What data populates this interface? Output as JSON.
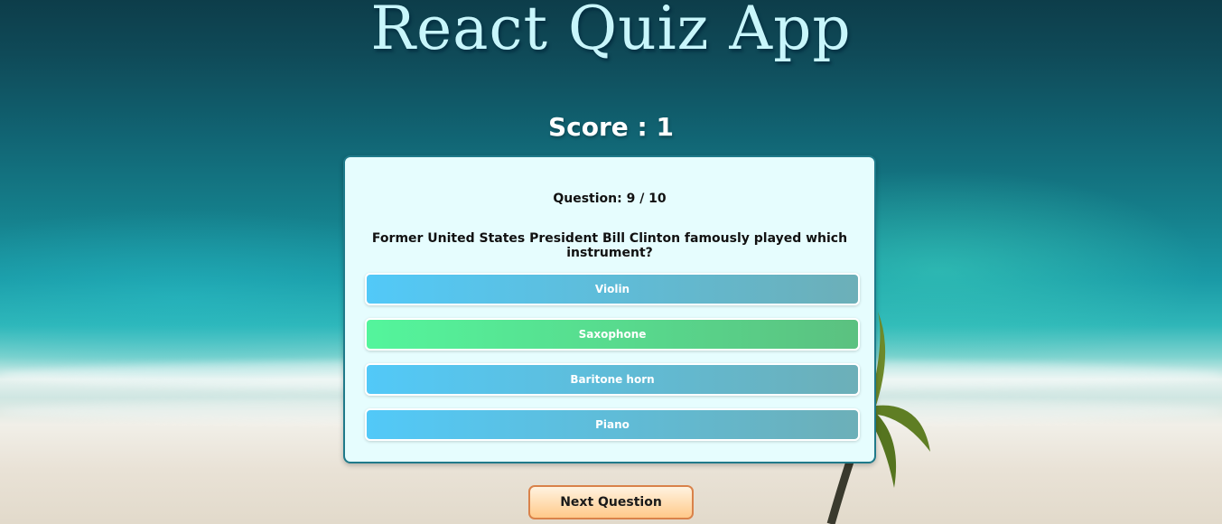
{
  "app": {
    "title": "React Quiz App"
  },
  "score": {
    "text": "Score : 1"
  },
  "quiz": {
    "question_count": "Question: 9 / 10",
    "question_text": "Former United States President Bill Clinton famously played which instrument?",
    "answers": [
      {
        "label": "Violin",
        "state": "default"
      },
      {
        "label": "Saxophone",
        "state": "correct"
      },
      {
        "label": "Baritone horn",
        "state": "default"
      },
      {
        "label": "Piano",
        "state": "default"
      }
    ]
  },
  "actions": {
    "next_label": "Next Question"
  },
  "colors": {
    "answer_default": "#52c9f8",
    "answer_correct": "#54f59c",
    "next_button": "#ffc989",
    "title": "#c8f6fb"
  }
}
